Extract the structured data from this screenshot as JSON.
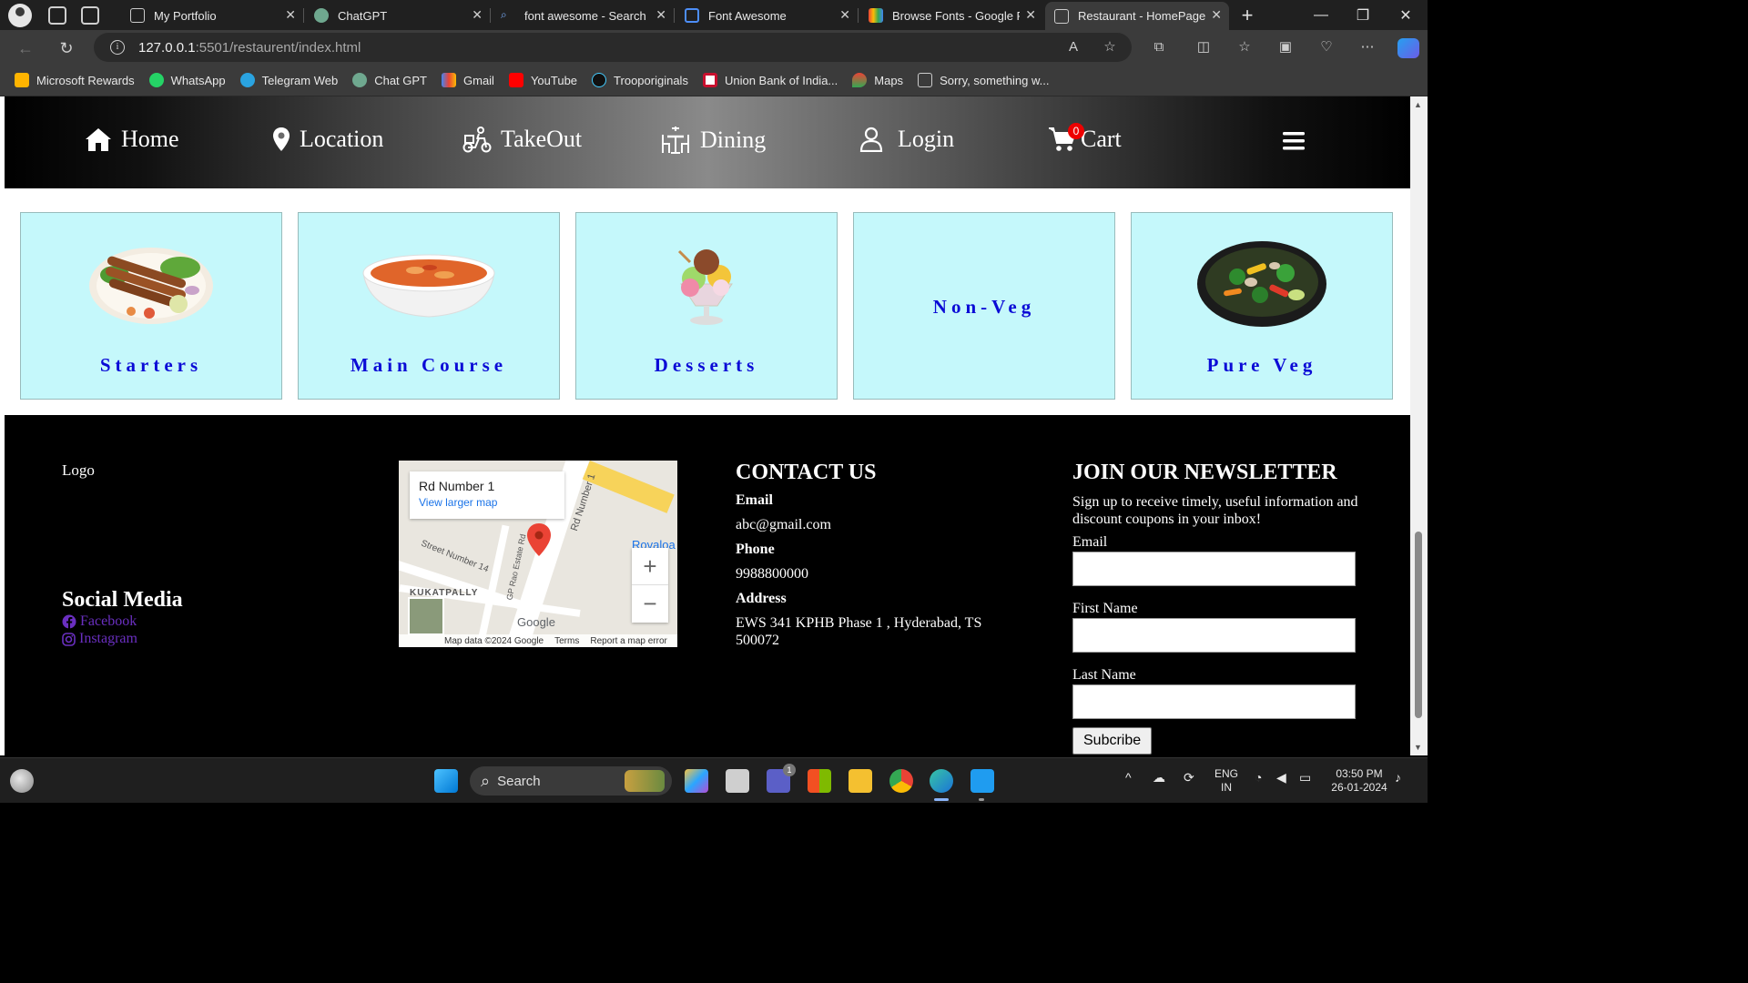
{
  "browser": {
    "tabs": [
      {
        "title": "My Portfolio",
        "active": false
      },
      {
        "title": "ChatGPT",
        "active": false
      },
      {
        "title": "font awesome - Search",
        "active": false
      },
      {
        "title": "Font Awesome",
        "active": false
      },
      {
        "title": "Browse Fonts - Google Fo",
        "active": false
      },
      {
        "title": "Restaurant - HomePage",
        "active": true
      }
    ],
    "url_host": "127.0.0.1",
    "url_rest": ":5501/restaurent/index.html",
    "bookmarks": [
      "Microsoft Rewards",
      "WhatsApp",
      "Telegram Web",
      "Chat GPT",
      "Gmail",
      "YouTube",
      "Trooporiginals",
      "Union Bank of India...",
      "Maps",
      "Sorry, something w..."
    ]
  },
  "site": {
    "nav": {
      "home": "Home",
      "location": "Location",
      "takeout": "TakeOut",
      "dining": "Dining",
      "login": "Login",
      "cart": "Cart",
      "cart_count": "0"
    },
    "categories": [
      {
        "label": "Starters",
        "icon": "seekh-kebab-plate"
      },
      {
        "label": "Main Course",
        "icon": "curry-bowl"
      },
      {
        "label": "Desserts",
        "icon": "ice-cream-sundae"
      },
      {
        "label": "Non-Veg",
        "icon": "none"
      },
      {
        "label": "Pure Veg",
        "icon": "veg-stir-fry-bowl"
      }
    ],
    "footer": {
      "logo": "Logo",
      "social_title": "Social Media",
      "facebook": "Facebook",
      "instagram": "Instagram",
      "map": {
        "place": "Rd Number 1",
        "larger_map": "View larger map",
        "label_street": "Street Number 14",
        "label_area": "KUKATPALLY",
        "label_rd": "Rd Number 1",
        "label_gp": "GP Rao Estate Rd",
        "label_rovaloa": "Rovaloa",
        "map_data": "Map data ©2024 Google",
        "terms": "Terms",
        "report": "Report a map error",
        "google": "Google"
      },
      "contact": {
        "title": "CONTACT US",
        "email_label": "Email",
        "email": "abc@gmail.com",
        "phone_label": "Phone",
        "phone": "9988800000",
        "address_label": "Address",
        "address": "EWS 341 KPHB Phase 1 , Hyderabad, TS 500072"
      },
      "newsletter": {
        "title": "JOIN OUR NEWSLETTER",
        "desc": "Sign up to receive timely, useful information and discount coupons in your inbox!",
        "email_label": "Email",
        "first_label": "First Name",
        "last_label": "Last Name",
        "button": "Subcribe"
      }
    }
  },
  "taskbar": {
    "search": "Search",
    "lang1": "ENG",
    "lang2": "IN",
    "time": "03:50 PM",
    "date": "26-01-2024",
    "teams_badge": "1"
  },
  "colors": {
    "card_bg": "#c5f8fb",
    "card_text": "#0b0bd6",
    "social_link": "#6a2fc0",
    "cart_badge": "#ee0000"
  }
}
